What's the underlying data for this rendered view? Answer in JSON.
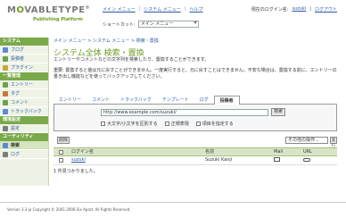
{
  "brand": {
    "logo_prefix": "M",
    "logo_o": "O",
    "logo_suffix": "VABLETYPE",
    "tm": "®",
    "sub": "Publishing Platform"
  },
  "topnav": {
    "items": [
      "メイン メニュー",
      "システム メニュー",
      "ヘルプ"
    ],
    "sep": "|"
  },
  "user": {
    "prefix": "現在のログイン名:",
    "name": "suzuki",
    "logout": "ログアウト"
  },
  "shortcut": {
    "label": "ショートカット:",
    "value": "メイン メニュー"
  },
  "sidebar": {
    "sections": [
      {
        "header": "システム",
        "items": [
          {
            "label": "ブログ",
            "icon": "blog-icon",
            "color": "#5b8ad6"
          },
          {
            "label": "投稿者",
            "icon": "user-icon",
            "color": "#6aa34a"
          },
          {
            "label": "プラグイン",
            "icon": "plugin-icon",
            "color": "#c9a53a"
          }
        ]
      },
      {
        "header": "一覧管理",
        "items": [
          {
            "label": "エントリー",
            "icon": "entry-icon",
            "color": "#6aa34a"
          },
          {
            "label": "タグ",
            "icon": "tag-icon",
            "color": "#c27b3a"
          },
          {
            "label": "コメント",
            "icon": "comment-icon",
            "color": "#6aa34a"
          },
          {
            "label": "トラックバック",
            "icon": "trackback-icon",
            "color": "#5b8ad6"
          }
        ]
      },
      {
        "header": "環境設定",
        "items": [
          {
            "label": "設定",
            "icon": "settings-icon",
            "color": "#7d7d7d"
          }
        ]
      },
      {
        "header": "ユーティリティ",
        "items": [
          {
            "label": "検索",
            "icon": "search-icon",
            "color": "#5b8ad6",
            "active": true
          },
          {
            "label": "ログ",
            "icon": "log-icon",
            "color": "#7d7d7d"
          }
        ]
      }
    ]
  },
  "breadcrumb": "メイン メニュー > システム メニュー > 検索・置換",
  "page_title": "システム全体",
  "page_subtitle": "検索・置換",
  "description": "エントリーやコメントなどの文字列を検索したり、置換することができます。",
  "notice": "重要: 置換すると値は元に戻すことができません。一度実行すると、元に戻すことはできません。不安な場合は、置換する前に、エントリーの書き出し機能などを使ってバックアップしてください。",
  "tabs": [
    "エントリー",
    "コメント",
    "トラックバック",
    "テンプレート",
    "ログ",
    "投稿者"
  ],
  "active_tab": 5,
  "search": {
    "value": "http://www.example.com/suzuki/",
    "button": "検索",
    "options": [
      "大文字/小文字を区別する",
      "正規表現",
      "項目を指定する"
    ]
  },
  "actions": {
    "delete": "削除",
    "select": "その他の操作...",
    "go": "実行"
  },
  "table": {
    "headers": {
      "name": "ログイン名",
      "fullname": "名前",
      "mail": "Mail",
      "url": "URL"
    },
    "rows": [
      {
        "name": "suzuki",
        "fullname": "Suzuki Kanji"
      }
    ]
  },
  "result_text": "1 件見つかりました。",
  "footer": "Version 3.3-ja Copyright © 2001-2006 Six Apart. All Rights Reserved."
}
